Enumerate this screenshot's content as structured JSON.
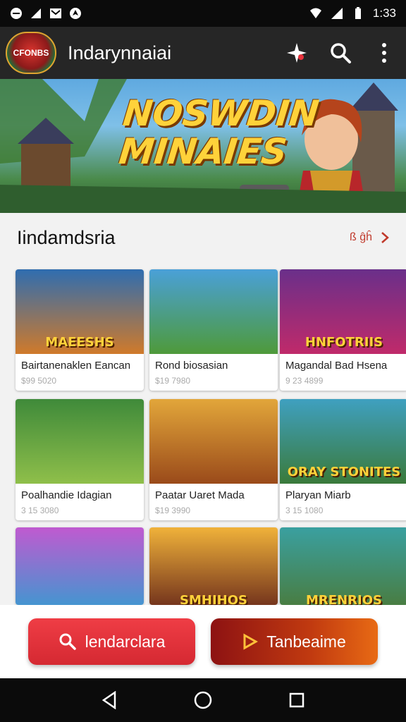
{
  "status_bar": {
    "time": "1:33"
  },
  "app_bar": {
    "logo_text": "CFONBS",
    "title": "Indarynnaiai"
  },
  "banner": {
    "title": "NOSWDIN MINAIES"
  },
  "section": {
    "title": "Iindamdsria",
    "see_all": "ß ĝĥ"
  },
  "games": [
    {
      "img_text": "MAEESHS",
      "name": "Bairtanenaklen Eancan",
      "price": "$99 5020"
    },
    {
      "img_text": "",
      "name": "Rond biosasian",
      "price": "$19 7980"
    },
    {
      "img_text": "HNFOTRIIS",
      "name": "Magandal Bad Hsena",
      "price": "9 23 4899"
    },
    {
      "img_text": "",
      "name": "Poalhandie Idagian",
      "price": "3 15 3080"
    },
    {
      "img_text": "",
      "name": "Paatar Uaret Mada",
      "price": "$19 3990"
    },
    {
      "img_text": "ORAY STONITES",
      "name": "Plaryan Miarb",
      "price": "3 15 1080"
    },
    {
      "img_text": "",
      "name": "",
      "price": ""
    },
    {
      "img_text": "SMHIHOS",
      "name": "",
      "price": ""
    },
    {
      "img_text": "MRENRIOS",
      "name": "",
      "price": ""
    }
  ],
  "actions": {
    "search_label": "lendarclara",
    "play_label": "Tanbeaime"
  },
  "colors": {
    "accent": "#e8323c",
    "app_bar": "#262626",
    "play_gradient_end": "#e86a14"
  }
}
